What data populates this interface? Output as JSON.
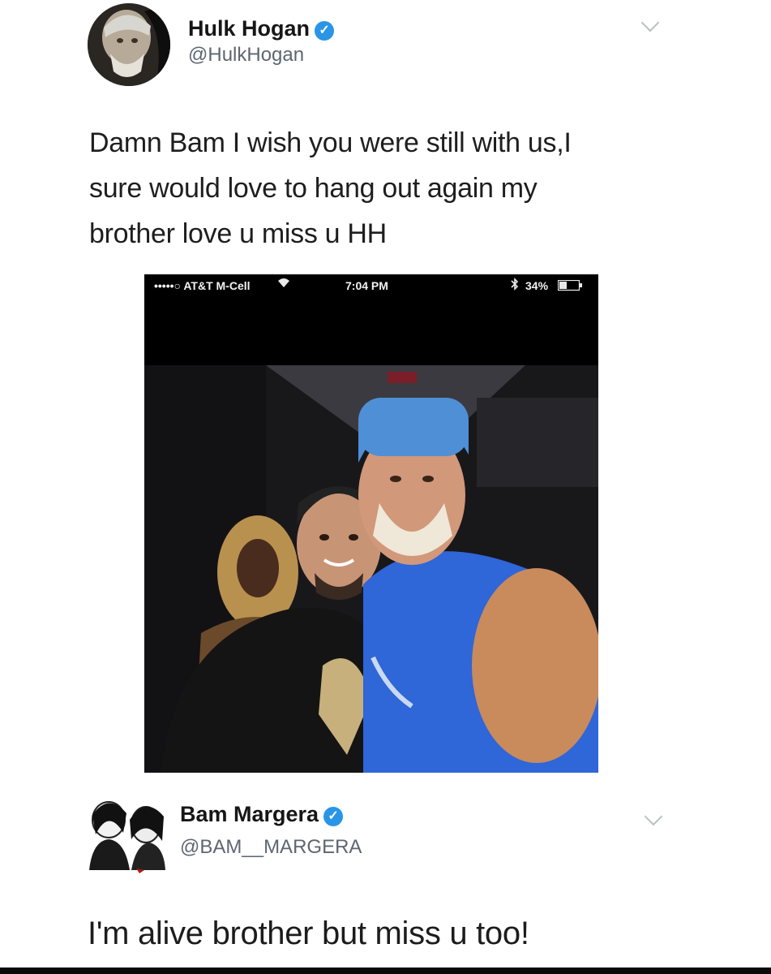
{
  "tweet": {
    "author_name": "Hulk Hogan",
    "author_handle": "@HulkHogan",
    "lines": [
      "Damn  Bam I wish you were still with us,I",
      "sure would love to hang out again my",
      "brother love u miss u HH"
    ],
    "verified_icon": "verified-check-icon",
    "menu_icon": "chevron-down-icon"
  },
  "phone_screenshot": {
    "carrier": "•••••○ AT&T M-Cell",
    "wifi_icon": "wifi-icon",
    "time": "7:04 PM",
    "bluetooth_icon": "bluetooth-icon",
    "battery": "34%",
    "battery_icon": "battery-icon"
  },
  "reply": {
    "author_name": "Bam Margera",
    "author_handle": "@BAM__MARGERA",
    "text": "I'm alive brother but miss u too!",
    "verified_icon": "verified-check-icon",
    "menu_icon": "chevron-down-icon"
  },
  "colors": {
    "verified": "#2a95e6",
    "handle": "#5e6670",
    "shirt_blue": "#2f66d8",
    "bandana_blue": "#4f8fd6"
  }
}
